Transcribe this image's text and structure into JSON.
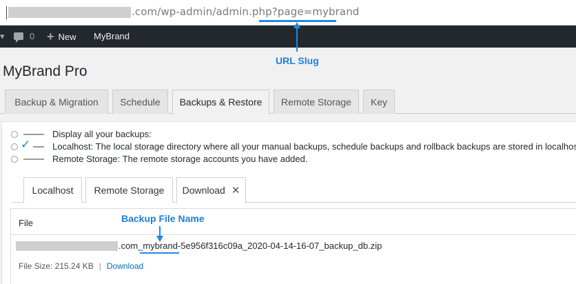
{
  "browser": {
    "url_visible": ".com/wp-admin/admin.php?page=mybrand"
  },
  "admin_bar": {
    "comments_count": "0",
    "new_label": "New",
    "site_name": "MyBrand"
  },
  "annotations": {
    "url_slug": "URL Slug",
    "backup_file_name": "Backup File Name"
  },
  "page": {
    "title": "MyBrand Pro"
  },
  "tabs": [
    {
      "label": "Backup & Migration"
    },
    {
      "label": "Schedule"
    },
    {
      "label": "Backups & Restore",
      "active": true
    },
    {
      "label": "Remote Storage"
    },
    {
      "label": "Key"
    }
  ],
  "legend": [
    {
      "text": "Display all your backups:"
    },
    {
      "text": "Localhost: The local storage directory where all your manual backups, schedule backups and rollback backups are stored in localhost."
    },
    {
      "text": "Remote Storage: The remote storage accounts you have added."
    }
  ],
  "sub_tabs": [
    {
      "label": "Localhost"
    },
    {
      "label": "Remote Storage"
    },
    {
      "label": "Download",
      "active": true,
      "close": "✕"
    }
  ],
  "file_table": {
    "header": "File",
    "file_name": ".com_mybrand-5e956f316c09a_2020-04-14-16-07_backup_db.zip",
    "file_size": "File Size: 215.24 KB",
    "separator": "|",
    "download_link": "Download"
  },
  "colors": {
    "accent": "#1e88e5",
    "admin_bar": "#23282d",
    "link": "#0073aa"
  }
}
